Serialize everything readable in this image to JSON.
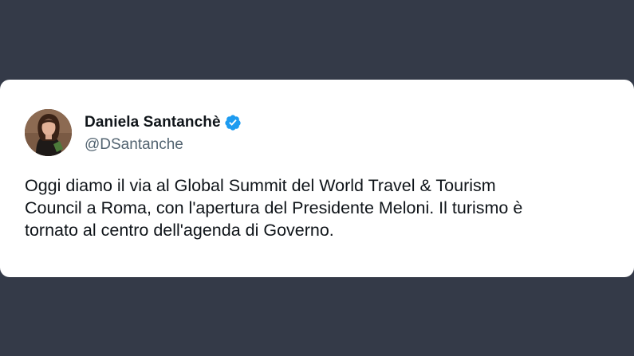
{
  "tweet": {
    "author": {
      "display_name": "Daniela Santanchè",
      "handle": "@DSantanche",
      "verified": true,
      "verified_icon": "verified-badge-icon",
      "verified_color": "#1d9bf0"
    },
    "text": "Oggi diamo il via al Global Summit del World Travel & Tourism\nCouncil a Roma, con l'apertura del Presidente Meloni. Il turismo è\ntornato al centro dell'agenda di Governo."
  },
  "colors": {
    "background": "#343a48",
    "card": "#ffffff",
    "text": "#0f1419",
    "muted": "#536471"
  }
}
